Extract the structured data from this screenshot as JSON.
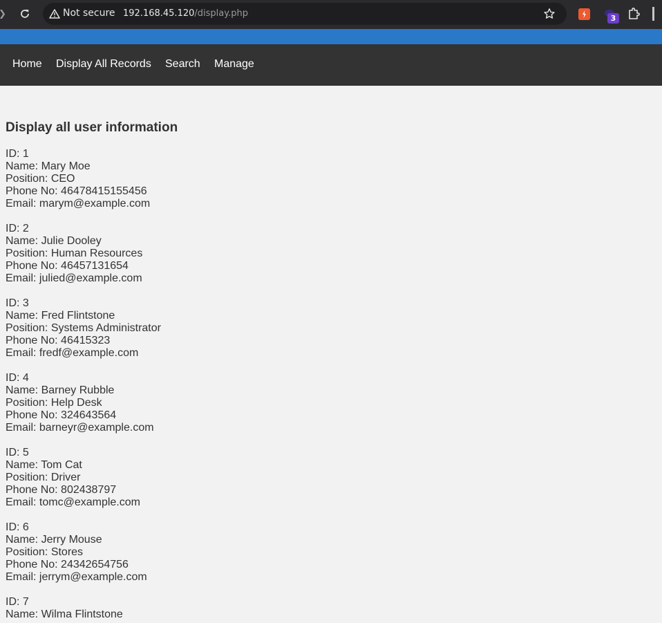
{
  "browser": {
    "security_label": "Not secure",
    "url_host": "192.168.45.120",
    "url_path": "/display.php",
    "extension_badge": "3"
  },
  "nav": {
    "items": [
      {
        "label": "Home"
      },
      {
        "label": "Display All Records"
      },
      {
        "label": "Search"
      },
      {
        "label": "Manage"
      }
    ]
  },
  "page": {
    "heading": "Display all user information"
  },
  "records": [
    {
      "id": "ID: 1",
      "name": "Name: Mary Moe",
      "position": "Position: CEO",
      "phone": "Phone No: 46478415155456",
      "email": "Email: marym@example.com"
    },
    {
      "id": "ID: 2",
      "name": "Name: Julie Dooley",
      "position": "Position: Human Resources",
      "phone": "Phone No: 46457131654",
      "email": "Email: julied@example.com"
    },
    {
      "id": "ID: 3",
      "name": "Name: Fred Flintstone",
      "position": "Position: Systems Administrator",
      "phone": "Phone No: 46415323",
      "email": "Email: fredf@example.com"
    },
    {
      "id": "ID: 4",
      "name": "Name: Barney Rubble",
      "position": "Position: Help Desk",
      "phone": "Phone No: 324643564",
      "email": "Email: barneyr@example.com"
    },
    {
      "id": "ID: 5",
      "name": "Name: Tom Cat",
      "position": "Position: Driver",
      "phone": "Phone No: 802438797",
      "email": "Email: tomc@example.com"
    },
    {
      "id": "ID: 6",
      "name": "Name: Jerry Mouse",
      "position": "Position: Stores",
      "phone": "Phone No: 24342654756",
      "email": "Email: jerrym@example.com"
    },
    {
      "id": "ID: 7",
      "name": "Name: Wilma Flintstone"
    }
  ],
  "colors": {
    "browser_bar": "#2b2b2e",
    "top_strip": "#2a78c8",
    "navbar": "#333333",
    "page_bg": "#f2f2f2",
    "text": "#333333"
  },
  "icons": [
    "back-arrow-icon",
    "reload-icon",
    "warning-icon",
    "star-icon",
    "extension-icon",
    "puzzle-icon"
  ]
}
